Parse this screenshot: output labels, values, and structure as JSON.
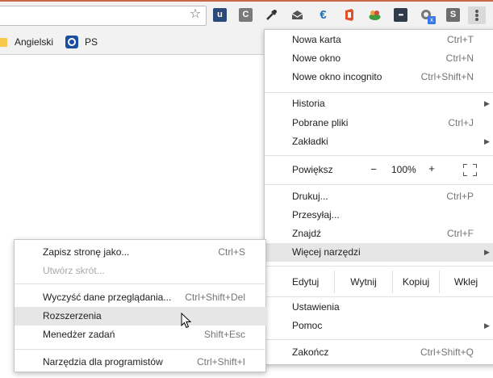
{
  "bookmarks": {
    "items": [
      {
        "label": "Angielski",
        "icon": "folder-icon"
      },
      {
        "label": "PS",
        "icon": "ps-icon"
      }
    ]
  },
  "toolbar": {
    "star_glyph": "☆",
    "extensions": [
      {
        "icon": "u-extension-icon",
        "glyph": "u",
        "color": "#2a4a7a"
      },
      {
        "icon": "c-extension-icon",
        "glyph": "C",
        "color": "#7a7a7a"
      },
      {
        "icon": "eyedropper-icon",
        "glyph": "",
        "color": "#333333"
      },
      {
        "icon": "mail-icon",
        "glyph": "",
        "color": "#555555"
      },
      {
        "icon": "euro-icon",
        "glyph": "€",
        "color": "#1f6fbf"
      },
      {
        "icon": "office-icon",
        "glyph": "",
        "color": "#e0522a"
      },
      {
        "icon": "basket-icon",
        "glyph": "",
        "color": "#3f9a3f"
      },
      {
        "icon": "more-dots-extension-icon",
        "glyph": "•••",
        "color": "#2f3a4a"
      },
      {
        "icon": "ghost-extension-icon",
        "glyph": "",
        "color": "#777777"
      },
      {
        "icon": "s-extension-icon",
        "glyph": "S",
        "color": "#6d6d6d"
      }
    ],
    "ghost_badge": "x"
  },
  "main_menu": {
    "new_tab": {
      "label": "Nowa karta",
      "shortcut": "Ctrl+T"
    },
    "new_window": {
      "label": "Nowe okno",
      "shortcut": "Ctrl+N"
    },
    "incognito": {
      "label": "Nowe okno incognito",
      "shortcut": "Ctrl+Shift+N"
    },
    "history": {
      "label": "Historia"
    },
    "downloads": {
      "label": "Pobrane pliki",
      "shortcut": "Ctrl+J"
    },
    "bookmarks": {
      "label": "Zakładki"
    },
    "zoom": {
      "label": "Powiększ",
      "minus": "−",
      "value": "100%",
      "plus": "+"
    },
    "print": {
      "label": "Drukuj...",
      "shortcut": "Ctrl+P"
    },
    "cast": {
      "label": "Przesyłaj..."
    },
    "find": {
      "label": "Znajdź",
      "shortcut": "Ctrl+F"
    },
    "more_tools": {
      "label": "Więcej narzędzi"
    },
    "edit": {
      "label": "Edytuj",
      "cut": "Wytnij",
      "copy": "Kopiuj",
      "paste": "Wklej"
    },
    "settings": {
      "label": "Ustawienia"
    },
    "help": {
      "label": "Pomoc"
    },
    "exit": {
      "label": "Zakończ",
      "shortcut": "Ctrl+Shift+Q"
    },
    "arrow_glyph": "▶"
  },
  "sub_menu": {
    "save_page": {
      "label": "Zapisz stronę jako...",
      "shortcut": "Ctrl+S"
    },
    "create_shortcut": {
      "label": "Utwórz skrót..."
    },
    "clear_data": {
      "label": "Wyczyść dane przeglądania...",
      "shortcut": "Ctrl+Shift+Del"
    },
    "extensions": {
      "label": "Rozszerzenia"
    },
    "task_manager": {
      "label": "Menedżer zadań",
      "shortcut": "Shift+Esc"
    },
    "dev_tools": {
      "label": "Narzędzia dla programistów",
      "shortcut": "Ctrl+Shift+I"
    }
  }
}
